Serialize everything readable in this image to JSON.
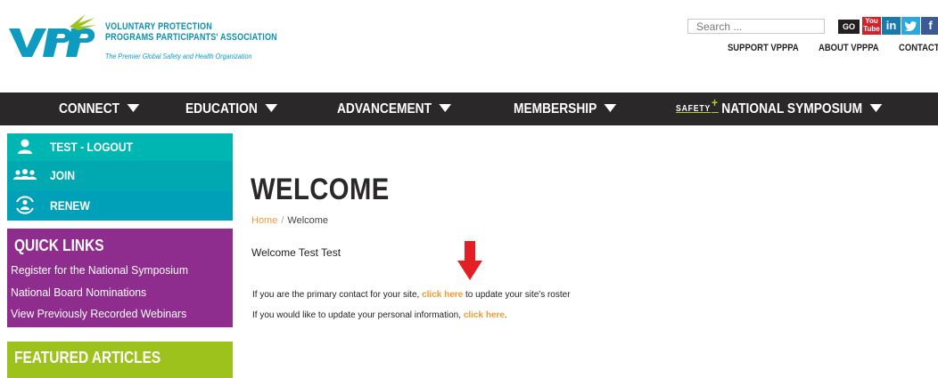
{
  "header": {
    "org_name_line1": "VOLUNTARY PROTECTION",
    "org_name_line2": "PROGRAMS PARTICIPANTS' ASSOCIATION",
    "tagline": "The Premier Global Safety and Health Organization",
    "logo_alt": "VPP"
  },
  "search": {
    "placeholder": "Search ...",
    "go_label": "GO"
  },
  "social": {
    "youtube": "You Tube",
    "linkedin": "in",
    "twitter": "t",
    "facebook": "f"
  },
  "top_links": {
    "support": "SUPPORT VPPPA",
    "about": "ABOUT VPPPA",
    "contact": "CONTACT"
  },
  "nav": {
    "connect": "CONNECT",
    "education": "EDUCATION",
    "advancement": "ADVANCEMENT",
    "membership": "MEMBERSHIP",
    "symposium_logo": "SAFETY",
    "symposium_plus": "+",
    "symposium": "NATIONAL SYMPOSIUM"
  },
  "sidebar": {
    "logout": "TEST - LOGOUT",
    "join": "JOIN",
    "renew": "RENEW",
    "quick_links_title": "QUICK LINKS",
    "quick_links": [
      "Register for the National Symposium",
      "National Board Nominations",
      "View Previously Recorded Webinars"
    ],
    "featured_title": "FEATURED ARTICLES"
  },
  "main": {
    "title": "WELCOME",
    "breadcrumb_home": "Home",
    "breadcrumb_sep": "/",
    "breadcrumb_current": "Welcome",
    "welcome": "Welcome Test Test",
    "line1_pre": "If you are the primary contact for your site, ",
    "line1_link": "click here",
    "line1_post": " to update your site's roster",
    "line2_pre": "If you would like to update your personal information, ",
    "line2_link": "click here",
    "line2_post": "."
  },
  "colors": {
    "nav_bg": "#2b2829",
    "teal": "#00b6b3",
    "purple": "#8e2d8e",
    "green": "#9cc21b",
    "link_orange": "#f29a32",
    "brand_blue": "#0e8fb0"
  }
}
